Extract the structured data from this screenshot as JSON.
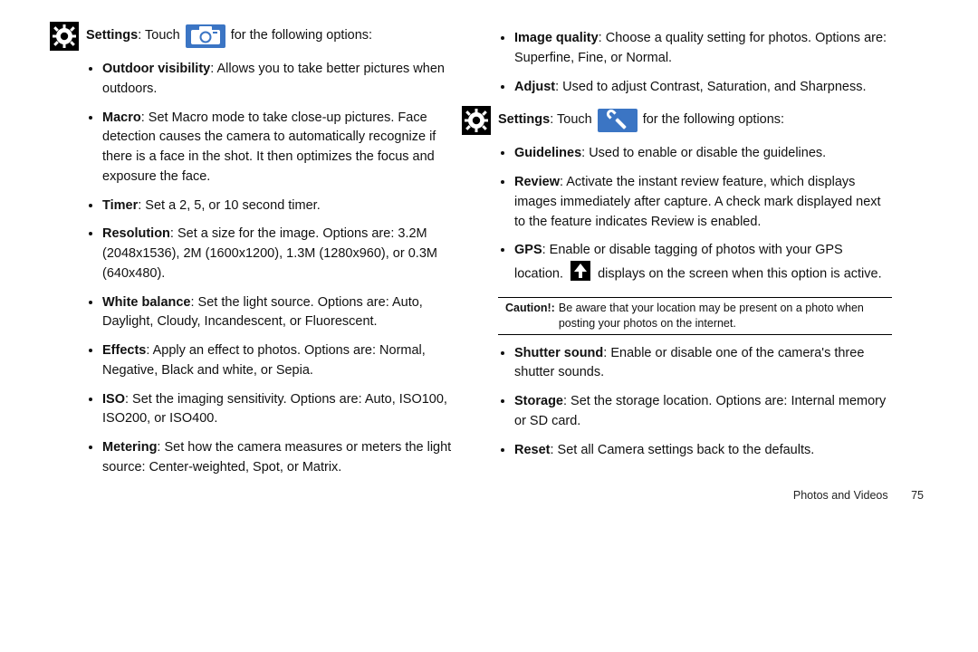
{
  "left": {
    "settings_label": "Settings",
    "touch": ": Touch",
    "after_icon": "for the following options:",
    "items": [
      {
        "t": "Outdoor visibility",
        "d": ": Allows you to take better pictures when outdoors."
      },
      {
        "t": "Macro",
        "d": ": Set Macro mode to take close-up pictures. Face detection causes the camera to automatically recognize if there is a face in the shot. It then optimizes the focus and exposure the face."
      },
      {
        "t": "Timer",
        "d": ": Set a 2, 5, or 10 second timer."
      },
      {
        "t": "Resolution",
        "d": ": Set a size for the image. Options are: 3.2M (2048x1536), 2M (1600x1200), 1.3M (1280x960), or 0.3M (640x480)."
      },
      {
        "t": "White balance",
        "d": ": Set the light source. Options are: Auto, Daylight, Cloudy, Incandescent, or Fluorescent."
      },
      {
        "t": "Effects",
        "d": ": Apply an effect to photos. Options are: Normal, Negative, Black and white, or Sepia."
      },
      {
        "t": "ISO",
        "d": ": Set the imaging sensitivity. Options are: Auto, ISO100, ISO200, or ISO400."
      },
      {
        "t": "Metering",
        "d": ": Set how the camera measures or meters the light source: Center-weighted, Spot, or Matrix."
      }
    ]
  },
  "right_top": [
    {
      "t": "Image quality",
      "d": ": Choose a quality setting for photos. Options are: Superfine, Fine, or Normal."
    },
    {
      "t": "Adjust",
      "d": ": Used to adjust Contrast, Saturation, and Sharpness."
    }
  ],
  "right": {
    "settings_label": "Settings",
    "touch": ": Touch",
    "after_icon": "for the following options:",
    "items_a": [
      {
        "t": "Guidelines",
        "d": ": Used to enable or disable the guidelines."
      },
      {
        "t": "Review",
        "d": ": Activate the instant review feature, which displays images immediately after capture. A check mark displayed next to the feature indicates Review is enabled."
      }
    ],
    "gps_t": "GPS",
    "gps_d1": ": Enable or disable tagging of photos with your GPS location.",
    "gps_d2": "displays on the screen when this option is active.",
    "caution_label": "Caution!:",
    "caution_text": "Be aware that your location may be present on a photo when posting your photos on the internet.",
    "items_b": [
      {
        "t": "Shutter sound",
        "d": ": Enable or disable one of the camera's three shutter sounds."
      },
      {
        "t": "Storage",
        "d": ": Set the storage location. Options are: Internal memory or SD card."
      },
      {
        "t": "Reset",
        "d": ": Set all Camera settings back to the defaults."
      }
    ]
  },
  "footer": {
    "section": "Photos and Videos",
    "page": "75"
  }
}
